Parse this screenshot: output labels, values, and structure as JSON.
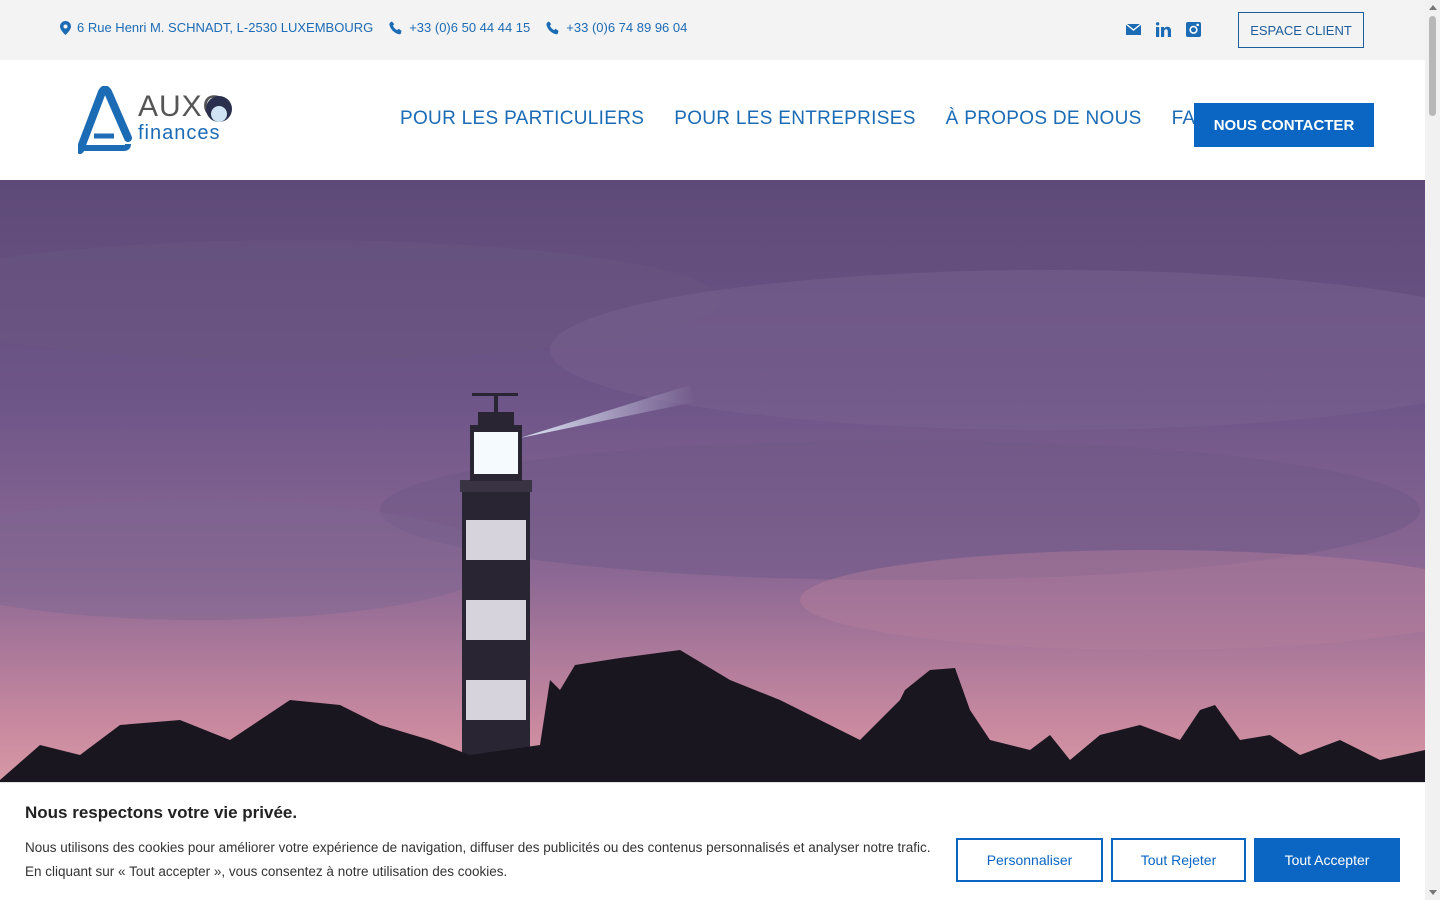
{
  "topbar": {
    "address": "6 Rue Henri M. SCHNADT, L-2530 LUXEMBOURG",
    "phone1": "+33 (0)6 50 44 44 15",
    "phone2": "+33 (0)6 74 89 96 04",
    "social_icons": [
      "mail-icon",
      "linkedin-icon",
      "instagram-icon"
    ],
    "espace_client": "ESPACE CLIENT"
  },
  "header": {
    "logo_name": "AUXO",
    "logo_sub": "finances",
    "nav": [
      "POUR LES PARTICULIERS",
      "POUR LES ENTREPRISES",
      "À PROPOS DE NOUS",
      "FAQ"
    ],
    "cta": "NOUS CONTACTER"
  },
  "cookie": {
    "title": "Nous respectons votre vie privée.",
    "text": "Nous utilisons des cookies pour améliorer votre expérience de navigation, diffuser des publicités ou des contenus personnalisés et analyser notre trafic. En cliquant sur « Tout accepter », vous consentez à notre utilisation des cookies.",
    "btn_customize": "Personnaliser",
    "btn_reject": "Tout Rejeter",
    "btn_accept": "Tout Accepter"
  },
  "colors": {
    "brand": "#0a66c2",
    "link": "#1c6bb5",
    "topbar_bg": "#f3f3f3"
  }
}
